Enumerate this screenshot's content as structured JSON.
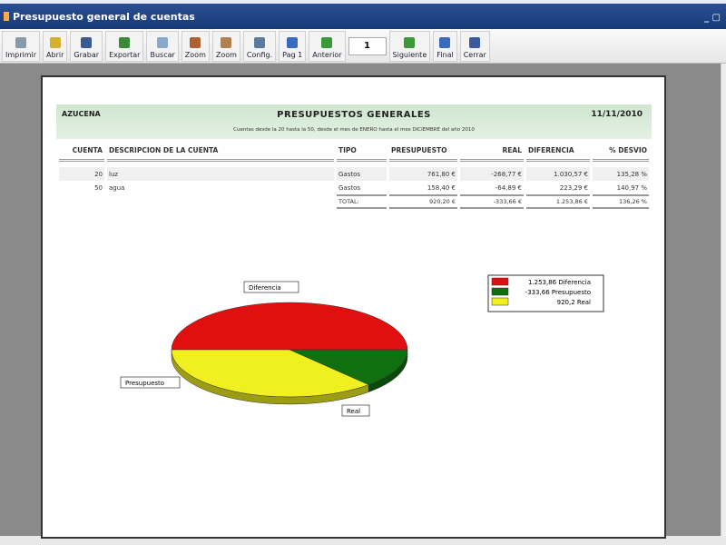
{
  "window": {
    "title": "Presupuesto general de cuentas"
  },
  "toolbar": {
    "buttons": [
      {
        "label": "Imprimir",
        "icon": "printer-icon",
        "color": "#8899aa"
      },
      {
        "label": "Abrir",
        "icon": "folder-open-icon",
        "color": "#d4b030"
      },
      {
        "label": "Grabar",
        "icon": "save-icon",
        "color": "#3a5a90"
      },
      {
        "label": "Exportar",
        "icon": "export-icon",
        "color": "#3a8a3a"
      },
      {
        "label": "Buscar",
        "icon": "search-icon",
        "color": "#8aa8cc"
      },
      {
        "label": "Zoom",
        "icon": "zoom-in-icon",
        "color": "#b06030"
      },
      {
        "label": "Zoom",
        "icon": "zoom-out-icon",
        "color": "#b08050"
      },
      {
        "label": "Config.",
        "icon": "config-icon",
        "color": "#5a7aa0"
      },
      {
        "label": "Pag 1",
        "icon": "first-page-icon",
        "color": "#3a6ac0"
      },
      {
        "label": "Anterior",
        "icon": "previous-icon",
        "color": "#3a9a3a"
      }
    ],
    "page_number": "1",
    "buttons2": [
      {
        "label": "Siguiente",
        "icon": "next-icon",
        "color": "#3a9a3a"
      },
      {
        "label": "Final",
        "icon": "last-page-icon",
        "color": "#3a6ac0"
      },
      {
        "label": "Cerrar",
        "icon": "close-door-icon",
        "color": "#3a5aa0"
      }
    ]
  },
  "report": {
    "company": "AZUCENA",
    "title": "PRESUPUESTOS GENERALES",
    "date": "11/11/2010",
    "subtitle": "Cuentas desde la 20 hasta la 50, desde el mes de ENERO hasta el mes DICIEMBRE del año 2010",
    "columns": [
      "CUENTA",
      "DESCRIPCION DE LA CUENTA",
      "TIPO",
      "PRESUPUESTO",
      "REAL",
      "DIFERENCIA",
      "% DESVIO"
    ],
    "rows": [
      [
        "20",
        "luz",
        "Gastos",
        "761,80 €",
        "-268,77 €",
        "1.030,57 €",
        "135,28 %"
      ],
      [
        "50",
        "agua",
        "Gastos",
        "158,40 €",
        "-64,89 €",
        "223,29 €",
        "140,97 %"
      ]
    ],
    "total": {
      "label": "TOTAL:",
      "presupuesto": "920,20 €",
      "real": "-333,66 €",
      "diferencia": "1.253,86 €",
      "desvio": "136,26 %"
    }
  },
  "chart_data": {
    "type": "pie",
    "title": "",
    "slices": [
      {
        "name": "Diferencia",
        "value": 1253.86,
        "legend": "1.253,86 Diferencia",
        "color": "#e01010"
      },
      {
        "name": "Presupuesto",
        "value": -333.66,
        "legend": "-333,66 Presupuesto",
        "color": "#107010"
      },
      {
        "name": "Real",
        "value": 920.2,
        "legend": "920,2 Real",
        "color": "#f0f020"
      }
    ],
    "legend_position": "right"
  }
}
